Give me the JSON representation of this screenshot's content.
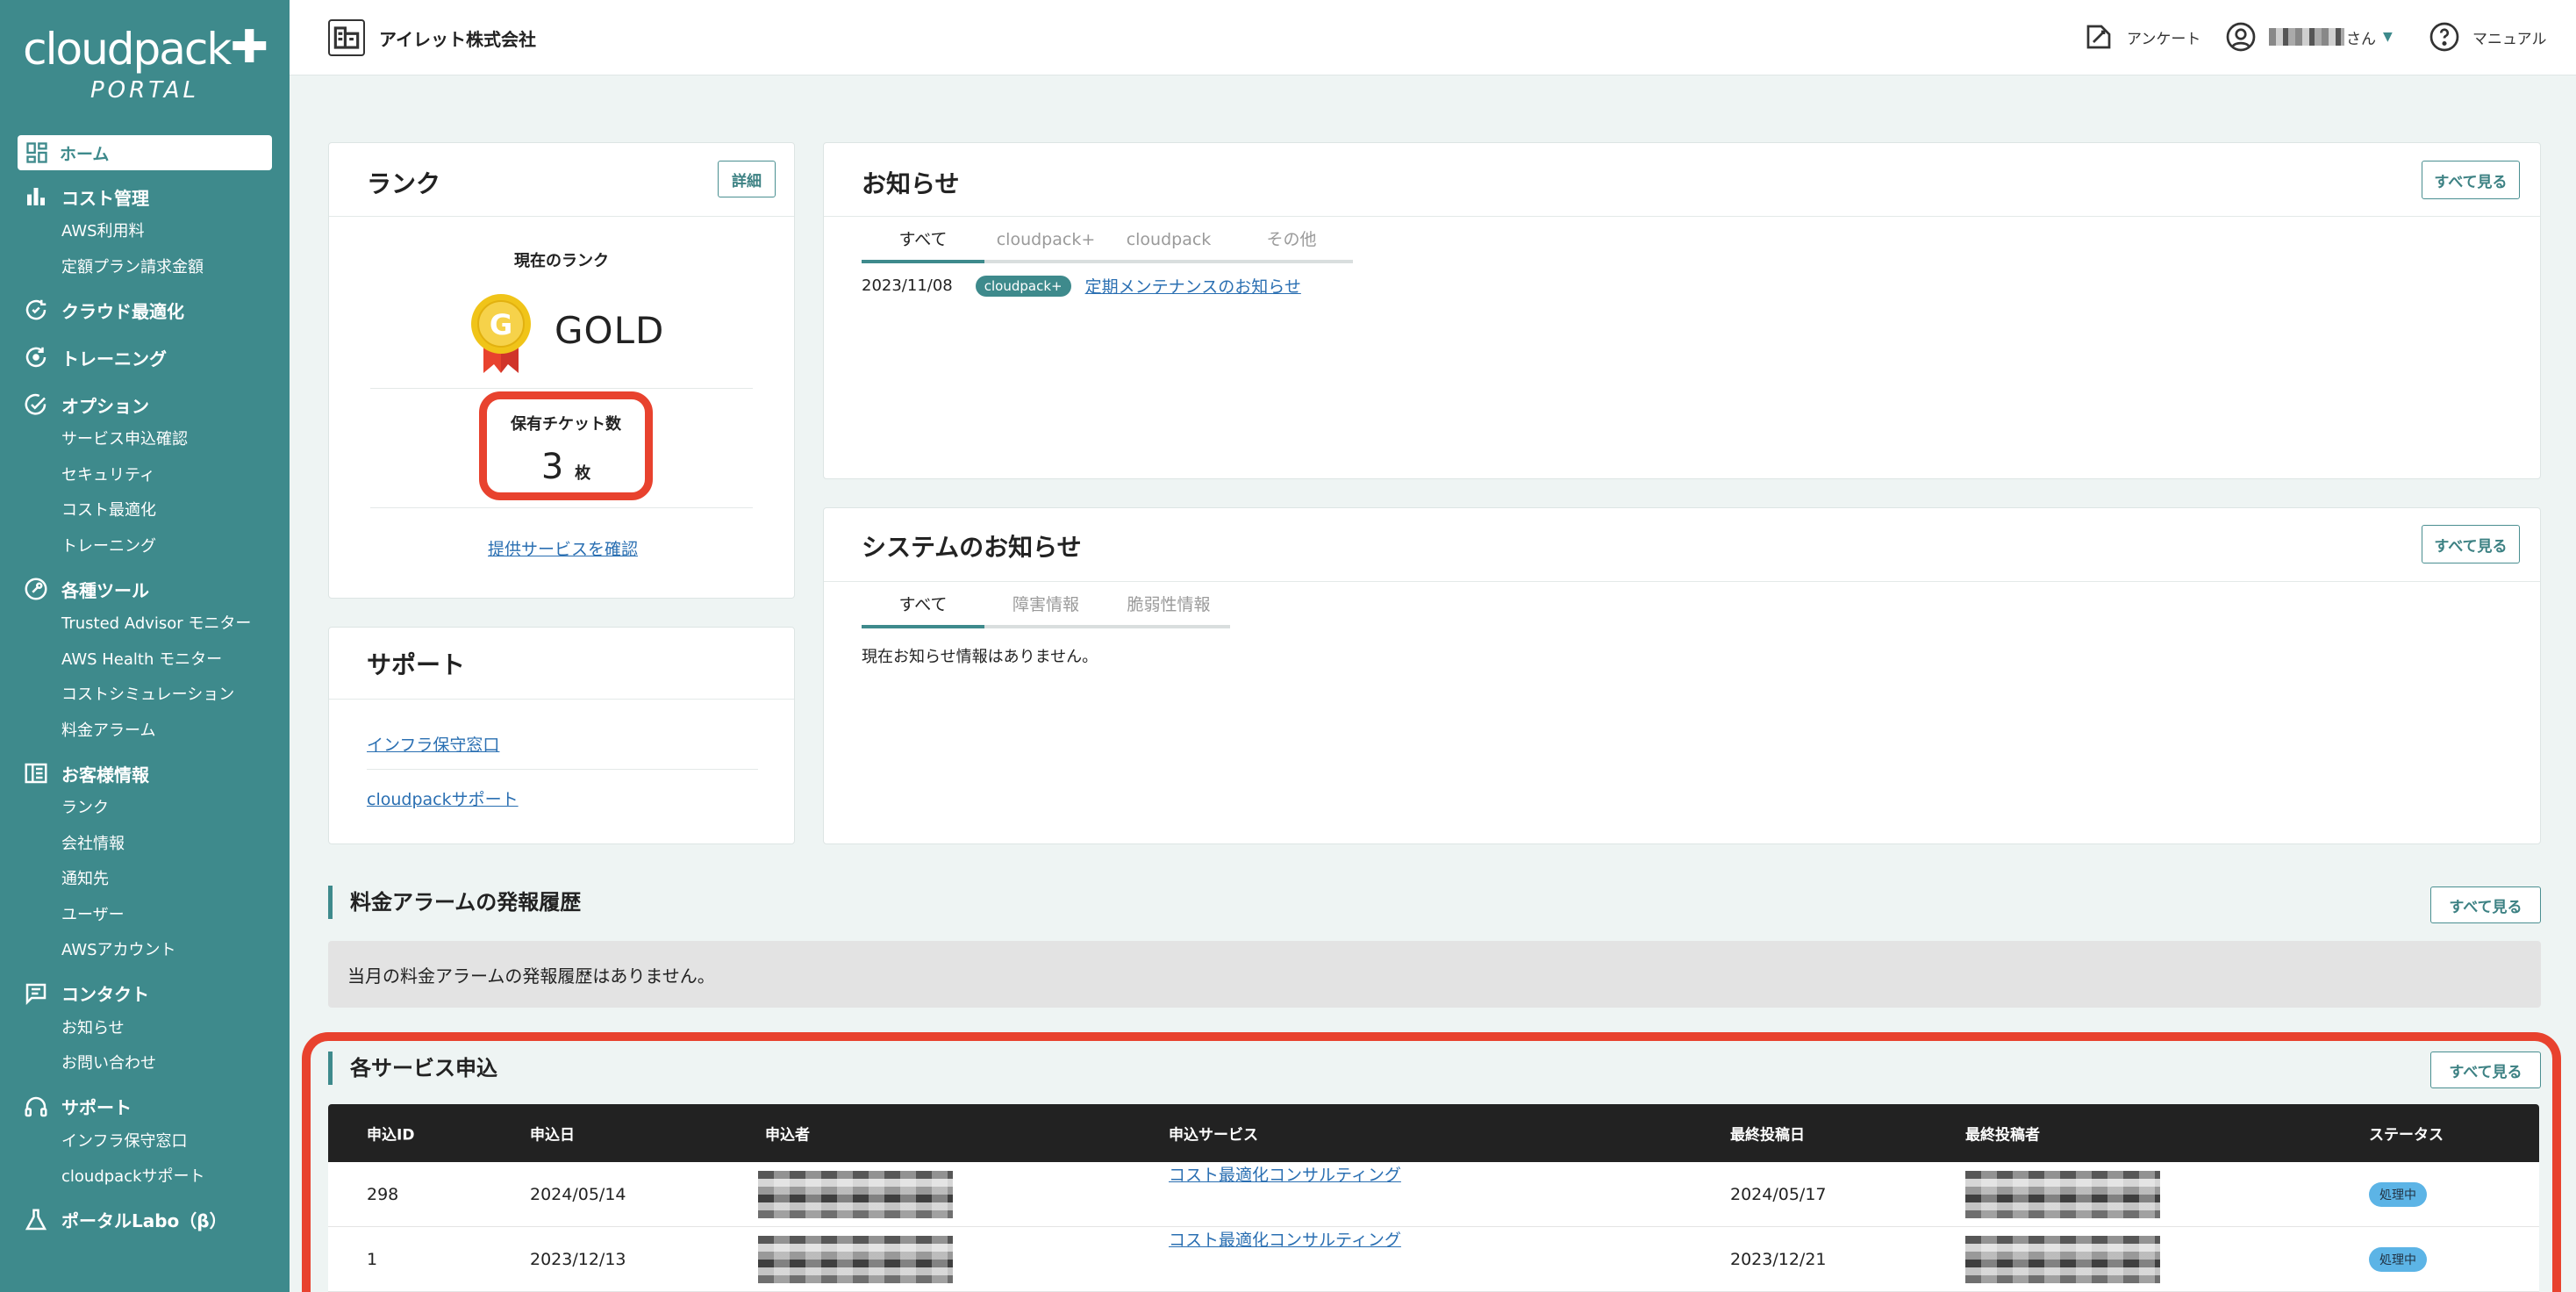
{
  "sidebar": {
    "logo": {
      "text": "cloudpack",
      "plus": "✚",
      "sub": "PORTAL"
    },
    "home": "ホーム",
    "sections": [
      {
        "label": "コスト管理",
        "icon": "bar-chart-icon",
        "items": [
          "AWS利用料",
          "定額プラン請求金額"
        ]
      },
      {
        "label": "クラウド最適化",
        "icon": "cloud-optimize-icon",
        "items": []
      },
      {
        "label": "トレーニング",
        "icon": "training-icon",
        "items": []
      },
      {
        "label": "オプション",
        "icon": "check-circle-icon",
        "items": [
          "サービス申込確認",
          "セキュリティ",
          "コスト最適化",
          "トレーニング"
        ]
      },
      {
        "label": "各種ツール",
        "icon": "tools-icon",
        "items": [
          "Trusted Advisor モニター",
          "AWS Health モニター",
          "コストシミュレーション",
          "料金アラーム"
        ]
      },
      {
        "label": "お客様情報",
        "icon": "building-icon",
        "items": [
          "ランク",
          "会社情報",
          "通知先",
          "ユーザー",
          "AWSアカウント"
        ]
      },
      {
        "label": "コンタクト",
        "icon": "message-icon",
        "items": [
          "お知らせ",
          "お問い合わせ"
        ]
      },
      {
        "label": "サポート",
        "icon": "headset-icon",
        "items": [
          "インフラ保守窓口",
          "cloudpackサポート"
        ]
      },
      {
        "label": "ポータルLabo（β）",
        "icon": "flask-icon",
        "items": []
      }
    ]
  },
  "header": {
    "company": "アイレット株式会社",
    "survey": "アンケート",
    "user_suffix": "さん",
    "manual": "マニュアル"
  },
  "rank": {
    "title": "ランク",
    "detail_button": "詳細",
    "current_label": "現在のランク",
    "medal_letter": "G",
    "rank_name": "GOLD",
    "ticket_label": "保有チケット数",
    "ticket_count": "3",
    "ticket_unit": "枚",
    "services_link": "提供サービスを確認"
  },
  "support": {
    "title": "サポート",
    "links": [
      "インフラ保守窓口",
      "cloudpackサポート"
    ]
  },
  "news": {
    "title": "お知らせ",
    "view_all": "すべて見る",
    "tabs": [
      "すべて",
      "cloudpack+",
      "cloudpack",
      "その他"
    ],
    "items": [
      {
        "date": "2023/11/08",
        "badge": "cloudpack+",
        "title": "定期メンテナンスのお知らせ"
      }
    ]
  },
  "system_news": {
    "title": "システムのお知らせ",
    "view_all": "すべて見る",
    "tabs": [
      "すべて",
      "障害情報",
      "脆弱性情報"
    ],
    "empty": "現在お知らせ情報はありません。"
  },
  "alarm": {
    "title": "料金アラームの発報履歴",
    "view_all": "すべて見る",
    "empty": "当月の料金アラームの発報履歴はありません。"
  },
  "services": {
    "title": "各サービス申込",
    "view_all": "すべて見る",
    "columns": [
      "申込ID",
      "申込日",
      "申込者",
      "申込サービス",
      "最終投稿日",
      "最終投稿者",
      "ステータス"
    ],
    "rows": [
      {
        "id": "298",
        "date": "2024/05/14",
        "service": "コスト最適化コンサルティング",
        "last_date": "2024/05/17",
        "status": "処理中"
      },
      {
        "id": "1",
        "date": "2023/12/13",
        "service": "コスト最適化コンサルティング",
        "last_date": "2023/12/21",
        "status": "処理中"
      }
    ]
  },
  "colors": {
    "accent": "#3e8a8c",
    "highlight": "#e8422e",
    "link": "#2a6fb2",
    "status": "#5cb4e6"
  }
}
